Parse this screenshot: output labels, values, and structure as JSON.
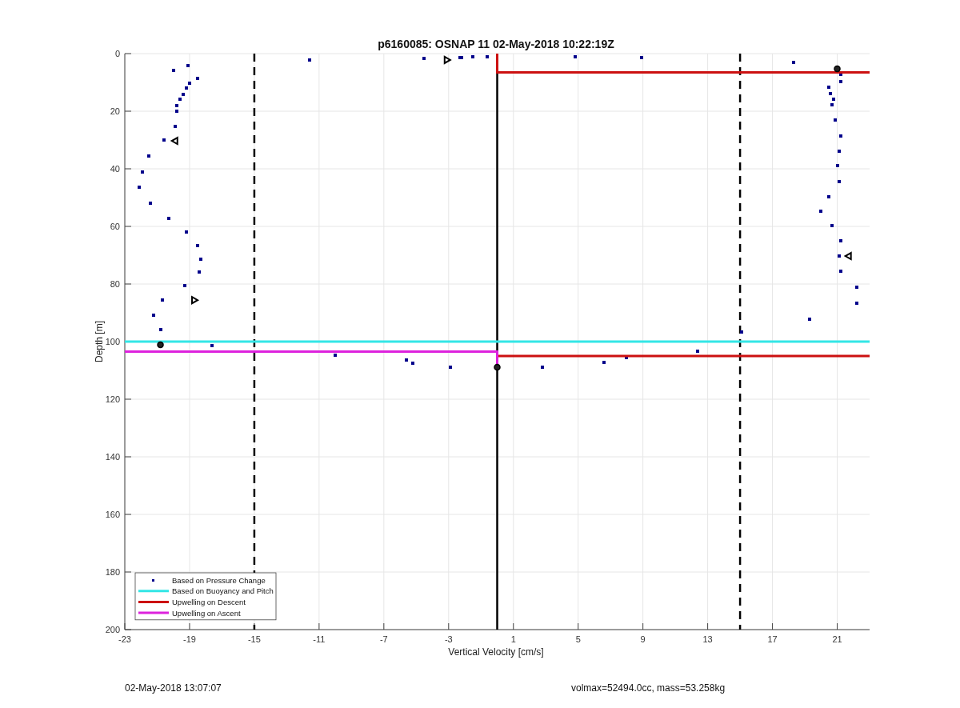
{
  "figure": {
    "chart_data": {
      "type": "scatter",
      "title": "p6160085: OSNAP 11 02-May-2018 10:22:19Z",
      "xlabel": "Vertical Velocity [cm/s]",
      "ylabel": "Depth [m]",
      "xlim": [
        -23,
        23
      ],
      "ylim": [
        200,
        0
      ],
      "grid": true,
      "legend": true,
      "xticks": [
        -23,
        -19,
        -15,
        -11,
        -7,
        -3,
        1,
        5,
        9,
        13,
        17,
        21
      ],
      "yticks": [
        0,
        20,
        40,
        60,
        80,
        100,
        120,
        140,
        160,
        180,
        200
      ],
      "x": [
        -19.1,
        -20.0,
        -18.5,
        -19.0,
        -19.2,
        -19.4,
        -19.6,
        -19.8,
        -19.8,
        -19.9,
        -20.6,
        -21.5,
        -21.9,
        -22.1,
        -21.4,
        -20.3,
        -19.2,
        -18.5,
        -18.3,
        -18.4,
        -19.3,
        -20.7,
        -21.2,
        -20.8,
        -17.6,
        -11.6,
        -4.5,
        -2.3,
        -2.2,
        -1.5,
        -0.6,
        4.8,
        8.9,
        -10.0,
        -5.6,
        -5.2,
        -2.9,
        2.8,
        6.6,
        8.0,
        12.4,
        15.1,
        18.3,
        21.2,
        21.2,
        20.5,
        20.6,
        20.8,
        20.7,
        20.9,
        21.2,
        21.1,
        21.0,
        21.1,
        20.5,
        20.0,
        20.7,
        21.2,
        21.1,
        21.2,
        22.2,
        22.2,
        19.3
      ],
      "series": [
        {
          "name": "Based on Pressure Change",
          "color": "#00008b",
          "values": [
            4.2,
            5.8,
            8.6,
            10.3,
            11.9,
            14.2,
            15.8,
            18.1,
            20.0,
            25.3,
            30.0,
            35.6,
            41.1,
            46.4,
            51.9,
            57.2,
            61.9,
            66.7,
            71.4,
            75.8,
            80.6,
            85.6,
            90.8,
            95.8,
            101.4,
            2.2,
            1.7,
            1.4,
            1.4,
            1.1,
            1.1,
            1.1,
            1.4,
            104.7,
            106.4,
            107.5,
            108.9,
            108.9,
            107.2,
            105.6,
            103.3,
            96.7,
            3.1,
            7.2,
            9.7,
            11.7,
            13.9,
            15.8,
            17.8,
            23.1,
            28.6,
            33.9,
            38.9,
            44.4,
            49.7,
            54.7,
            59.7,
            65.0,
            70.3,
            75.6,
            81.1,
            86.7,
            92.2
          ]
        }
      ],
      "ref_lines": [
        {
          "axis": "x",
          "value": -15,
          "color": "#000000"
        },
        {
          "axis": "x",
          "value": 15,
          "color": "#000000"
        },
        {
          "axis": "x",
          "value": 0,
          "color": "#000000"
        },
        {
          "axis": "y",
          "value": 100,
          "label": "Based on Buoyancy and Pitch",
          "color": "#33e6e6"
        }
      ]
    },
    "upwelling": [
      {
        "label": "Upwelling on Descent",
        "color": "#cc1111"
      },
      {
        "label": "Upwelling on Ascent",
        "color": "#dd22dd"
      }
    ]
  },
  "footer": {
    "left": "02-May-2018 13:07:07",
    "right": "volmax=52494.0cc, mass=53.258kg"
  }
}
